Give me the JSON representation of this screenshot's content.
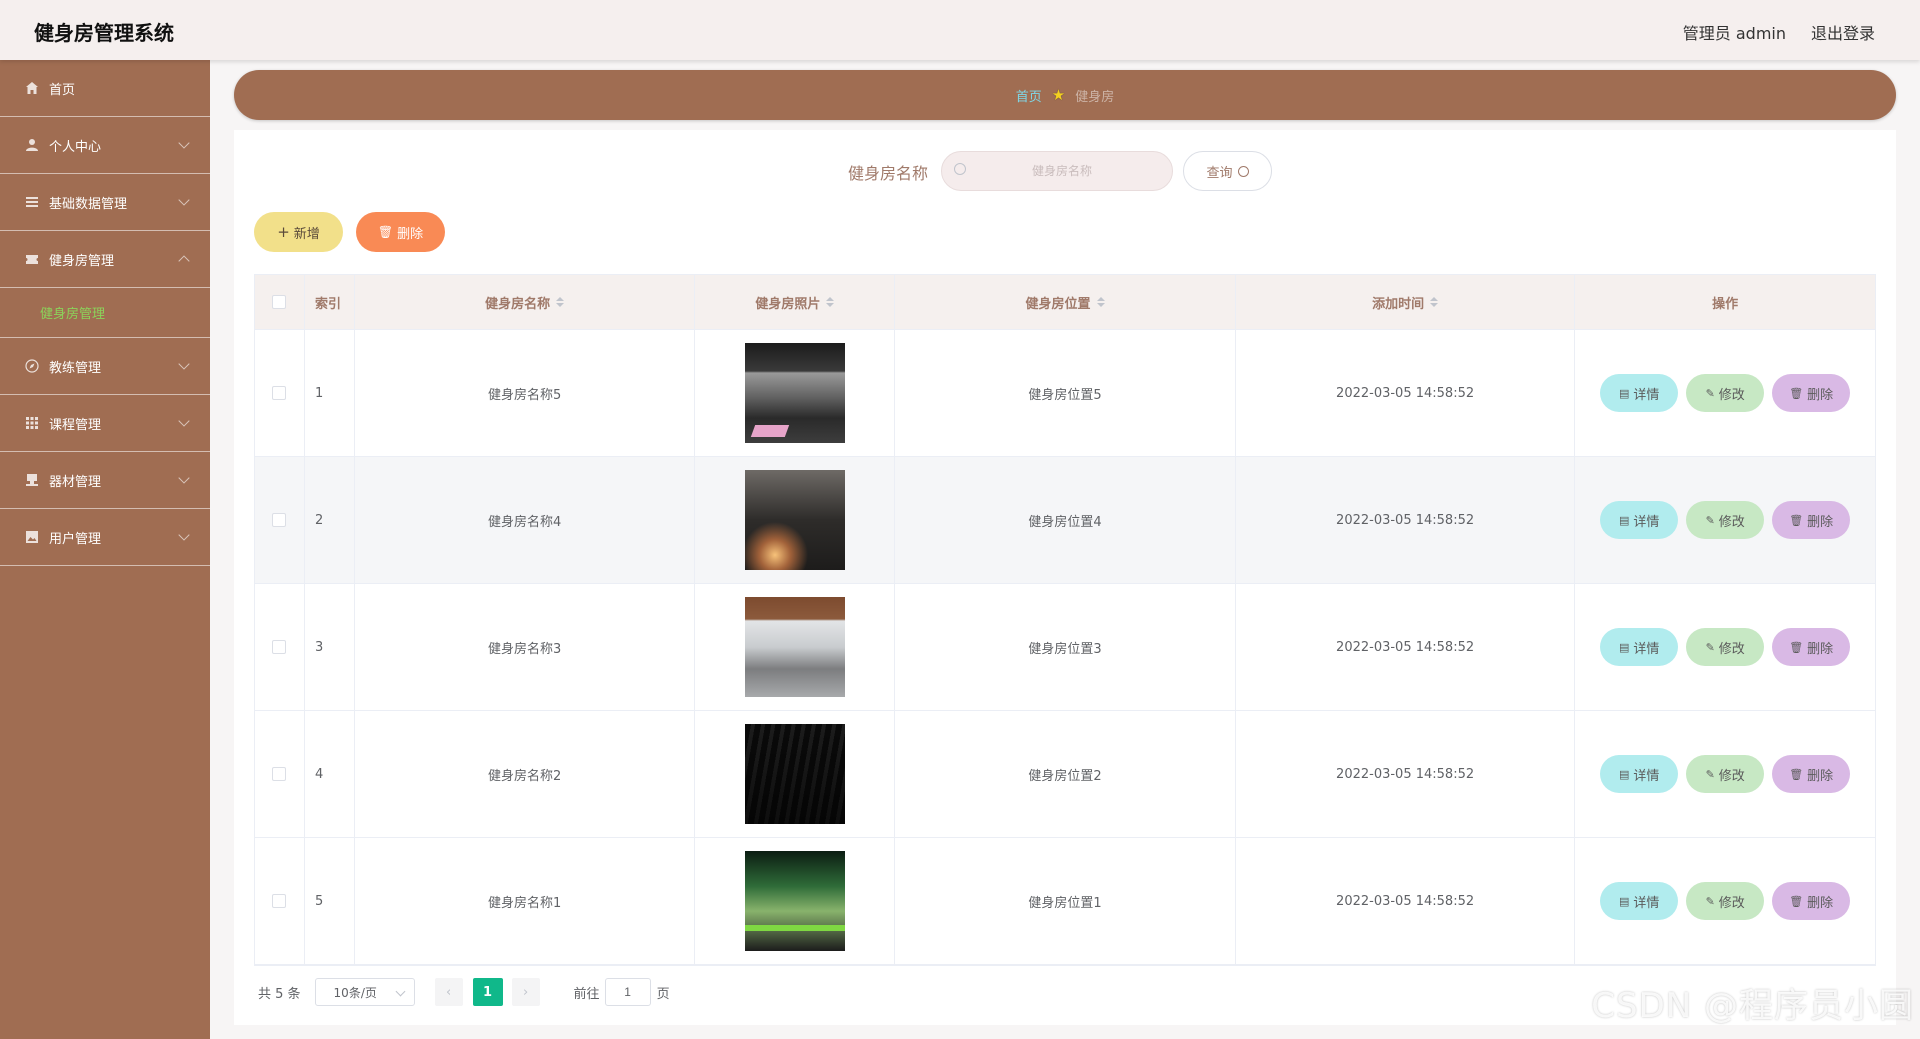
{
  "header": {
    "title": "健身房管理系统",
    "user": "管理员 admin",
    "logout": "退出登录"
  },
  "sidebar": {
    "items": [
      {
        "label": "首页",
        "icon": "home-icon"
      },
      {
        "label": "个人中心",
        "icon": "user-icon"
      },
      {
        "label": "基础数据管理",
        "icon": "list-icon"
      },
      {
        "label": "健身房管理",
        "icon": "ticket-icon"
      },
      {
        "label": "教练管理",
        "icon": "compass-icon"
      },
      {
        "label": "课程管理",
        "icon": "grid-icon"
      },
      {
        "label": "器材管理",
        "icon": "stamp-icon"
      },
      {
        "label": "用户管理",
        "icon": "picture-icon"
      }
    ],
    "active_sub": "健身房管理"
  },
  "breadcrumb": {
    "home": "首页",
    "current": "健身房"
  },
  "search": {
    "label": "健身房名称",
    "placeholder": "健身房名称",
    "button": "查询"
  },
  "actions": {
    "add": "新增",
    "delete": "删除"
  },
  "table": {
    "columns": [
      "索引",
      "健身房名称",
      "健身房照片",
      "健身房位置",
      "添加时间",
      "操作"
    ],
    "rows": [
      {
        "index": "1",
        "name": "健身房名称5",
        "location": "健身房位置5",
        "time": "2022-03-05 14:58:52"
      },
      {
        "index": "2",
        "name": "健身房名称4",
        "location": "健身房位置4",
        "time": "2022-03-05 14:58:52"
      },
      {
        "index": "3",
        "name": "健身房名称3",
        "location": "健身房位置3",
        "time": "2022-03-05 14:58:52"
      },
      {
        "index": "4",
        "name": "健身房名称2",
        "location": "健身房位置2",
        "time": "2022-03-05 14:58:52"
      },
      {
        "index": "5",
        "name": "健身房名称1",
        "location": "健身房位置1",
        "time": "2022-03-05 14:58:52"
      }
    ],
    "ops": {
      "detail": "详情",
      "edit": "修改",
      "delete": "删除"
    }
  },
  "pagination": {
    "total": "共 5 条",
    "page_size": "10条/页",
    "current": "1",
    "goto": "前往",
    "goto_value": "1",
    "page_unit": "页"
  },
  "watermark": "CSDN @程序员小圆",
  "colors": {
    "sidebar": "#a06d52",
    "accent_green": "#10b88a",
    "detail_btn": "#b1ecee",
    "edit_btn": "#c7e8c4",
    "delete_btn": "#d9b9e5"
  }
}
